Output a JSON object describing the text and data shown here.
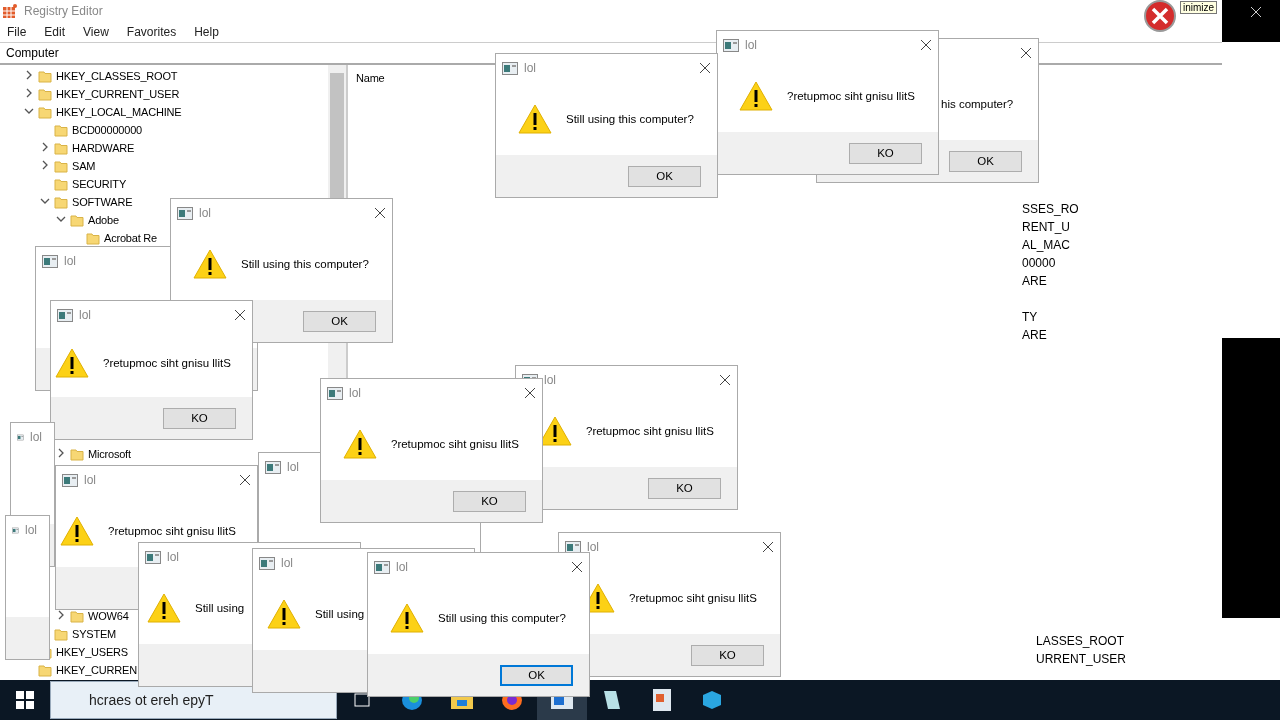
{
  "registry_editor": {
    "title": "Registry Editor",
    "menu": [
      "File",
      "Edit",
      "View",
      "Favorites",
      "Help"
    ],
    "address": "Computer",
    "list_header": "Name",
    "tree": [
      {
        "label": "HKEY_CLASSES_ROOT",
        "expanded": false
      },
      {
        "label": "HKEY_CURRENT_USER",
        "expanded": false
      },
      {
        "label": "HKEY_LOCAL_MACHINE",
        "expanded": true,
        "children": [
          {
            "label": "BCD00000000"
          },
          {
            "label": "HARDWARE",
            "expanded": false
          },
          {
            "label": "SAM",
            "expanded": false
          },
          {
            "label": "SECURITY"
          },
          {
            "label": "SOFTWARE",
            "expanded": true,
            "children": [
              {
                "label": "Adobe",
                "expanded": true,
                "children": [
                  {
                    "label": "Acrobat Re"
                  }
                ]
              },
              {
                "label": "Microsoft",
                "expanded": false
              },
              {
                "label": "WOW64",
                "expanded": false
              }
            ]
          },
          {
            "label": "SYSTEM"
          }
        ]
      },
      {
        "label": "HKEY_USERS"
      },
      {
        "label": "HKEY_CURREN"
      }
    ]
  },
  "dialogs": [
    {
      "message": "his computer?",
      "button": "OK",
      "focused": false
    },
    {
      "title": "lol",
      "message": "?retupmoc siht gnisu llitS",
      "button": "KO",
      "focused": false
    },
    {
      "title": "lol",
      "message": "Still using this computer?",
      "button": "OK",
      "focused": false
    },
    {
      "title": "lol"
    },
    {
      "title": "lol",
      "message": "Still using this computer?",
      "button": "OK",
      "focused": false
    },
    {
      "title": "lol",
      "message": "?retupmoc siht gnisu llitS",
      "button": "KO",
      "focused": false
    },
    {
      "title": "lol"
    },
    {
      "title": "lol"
    },
    {
      "title": "lol",
      "message": "?retupmoc siht gnisu llitS",
      "button": "KO",
      "focused": false
    },
    {
      "title": "lol",
      "message": "?retupmoc siht gnisu llitS"
    },
    {
      "title": "lol"
    },
    {
      "title": "lol",
      "message": "?retupmoc siht gnisu llitS",
      "button": "KO",
      "focused": false
    },
    {
      "title": "lol",
      "message": "?retupmoc siht gnisu llitS",
      "button": "KO",
      "focused": false
    },
    {
      "title": "lol",
      "message": "Still using"
    },
    {
      "title": "lol",
      "message": "Still using"
    },
    {
      "title": "lol",
      "message": "Still using this computer?",
      "button": "OK",
      "focused": true
    }
  ],
  "fragments": [
    "SSES_RO",
    "RENT_U",
    "AL_MAC",
    "00000",
    "ARE",
    "TY",
    "ARE"
  ],
  "fragments_bottom": [
    "LASSES_ROOT",
    "URRENT_USER"
  ],
  "tooltip": "inimize",
  "taskbar": {
    "search": {
      "placeholder": "hcraes ot ereh epyT"
    }
  }
}
